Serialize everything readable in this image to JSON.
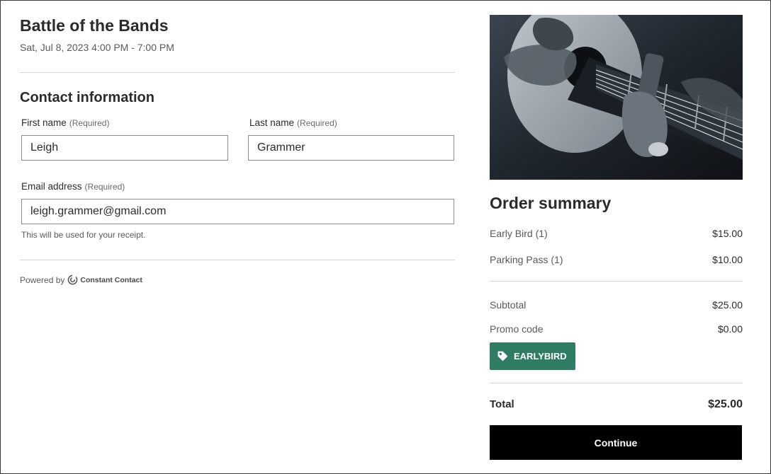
{
  "event": {
    "title": "Battle of the Bands",
    "date": "Sat, Jul 8, 2023 4:00 PM - 7:00 PM"
  },
  "contact": {
    "section_title": "Contact information",
    "required_label": "(Required)",
    "first_name": {
      "label": "First name",
      "value": "Leigh"
    },
    "last_name": {
      "label": "Last name",
      "value": "Grammer"
    },
    "email": {
      "label": "Email address",
      "value": "leigh.grammer@gmail.com",
      "helper": "This will be used for your receipt."
    }
  },
  "footer": {
    "powered_by": "Powered by",
    "brand": "Constant Contact"
  },
  "order": {
    "title": "Order summary",
    "items": [
      {
        "name": "Early Bird (1)",
        "amount": "$15.00"
      },
      {
        "name": "Parking Pass (1)",
        "amount": "$10.00"
      }
    ],
    "subtotal": {
      "label": "Subtotal",
      "amount": "$25.00"
    },
    "promo": {
      "label": "Promo code",
      "amount": "$0.00",
      "code": "EARLYBIRD"
    },
    "total": {
      "label": "Total",
      "amount": "$25.00"
    },
    "continue_label": "Continue"
  },
  "colors": {
    "promo_tag": "#2e7d62",
    "continue_button": "#000000"
  },
  "icons": {
    "promo": "tag-icon",
    "brand": "constant-contact-logo-icon"
  }
}
